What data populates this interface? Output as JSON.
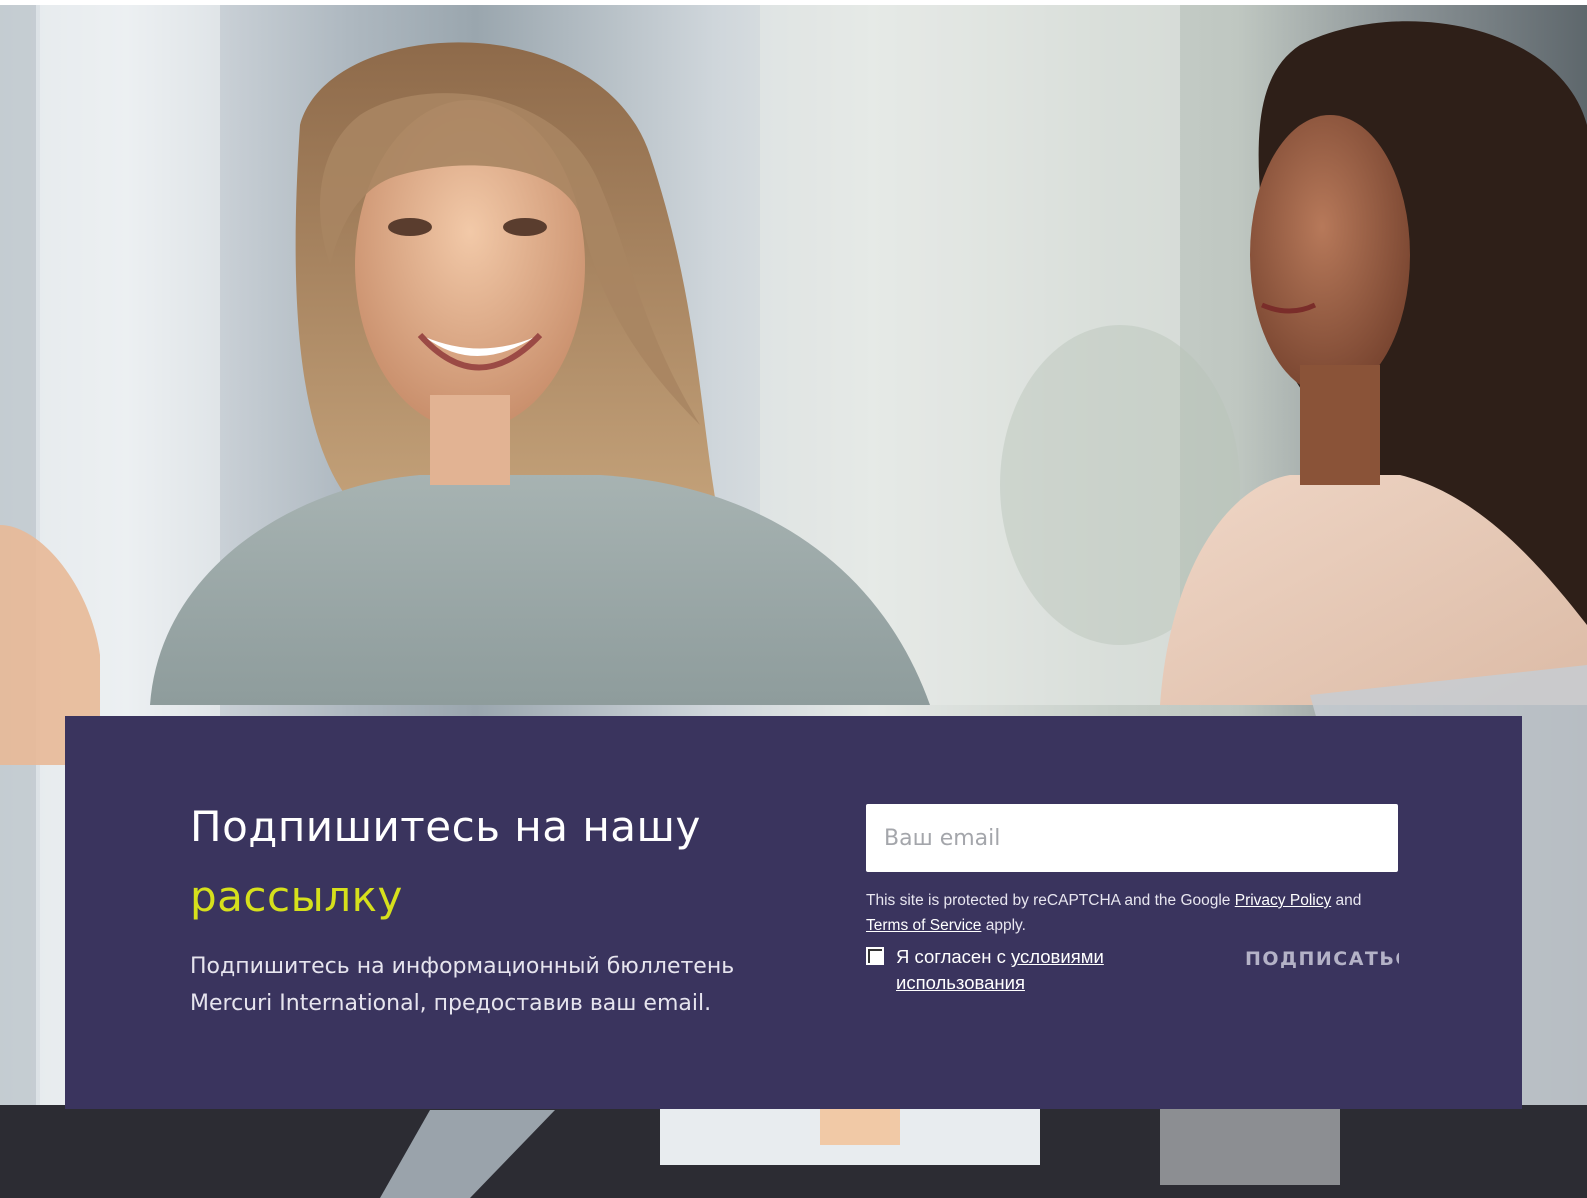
{
  "hero": {
    "image_description_icon": "office-meeting-photo-icon"
  },
  "signup": {
    "headline_main": "Подпишитесь на нашу",
    "headline_accent": "рассылку",
    "lead": "Подпишитесь на информационный бюллетень Mercuri International, предоставив ваш email.",
    "email_placeholder": "Ваш email",
    "recaptcha_prefix": "This site is protected by reCAPTCHA and the Google ",
    "privacy_link": "Privacy Policy",
    "recaptcha_and": " and ",
    "terms_link": "Terms of Service",
    "recaptcha_suffix": " apply.",
    "consent_prefix": "Я согласен с ",
    "consent_link": "условиями использования",
    "subscribe_label": "ПОДПИСАТЬСЯ"
  },
  "colors": {
    "panel_bg": "#3a345e",
    "accent": "#d6e01c",
    "button_text": "#b4b2c7"
  }
}
